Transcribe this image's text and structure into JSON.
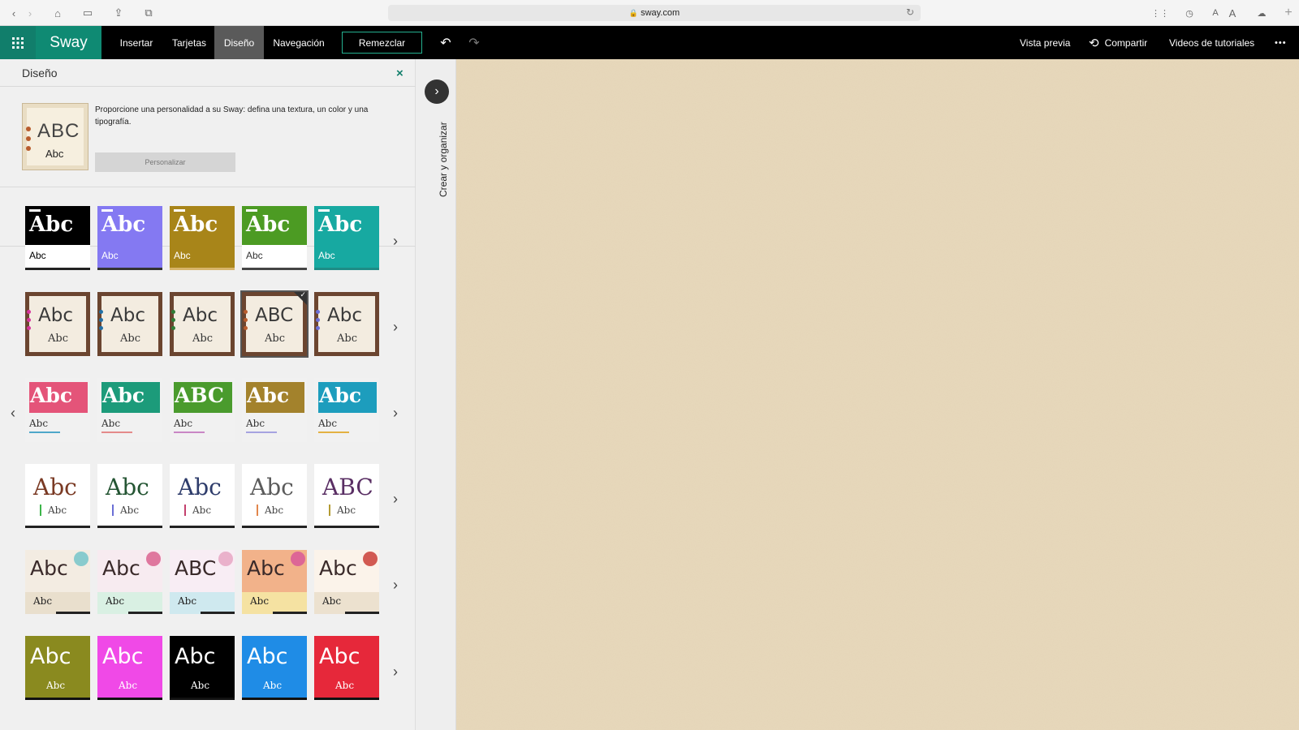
{
  "browser": {
    "url": "sway.com"
  },
  "app": {
    "name": "Sway",
    "tabs": [
      "Insertar",
      "Tarjetas",
      "Diseño",
      "Navegación"
    ],
    "active_tab": "Diseño",
    "remix_label": "Remezclar",
    "preview_label": "Vista previa",
    "share_label": "Compartir",
    "tutorials_label": "Videos de tutoriales",
    "more_label": "•••"
  },
  "design_panel": {
    "title": "Diseño",
    "close_glyph": "×",
    "intro_text": "Proporcione una personalidad a su Sway: defina una textura, un color y una tipografía.",
    "customize_label": "Personalizar",
    "thumb_heading": "ABC",
    "thumb_sub": "Abc"
  },
  "strip": {
    "label": "Crear y organizar",
    "expand_glyph": "›"
  },
  "style_rows": [
    {
      "kind": "solid-bar",
      "tiles": [
        {
          "bg": "#000000",
          "heading": "Abc",
          "sub": "Abc",
          "text": "#ffffff",
          "accent": "#222222",
          "subBg": "#ffffff",
          "subText": "#000000"
        },
        {
          "bg": "#8479f2",
          "heading": "Abc",
          "sub": "Abc",
          "text": "#ffffff",
          "accent": "#333333",
          "subBg": "#8479f2",
          "subText": "#ffffff"
        },
        {
          "bg": "#a88519",
          "heading": "Abc",
          "sub": "Abc",
          "text": "#ffffff",
          "accent": "#d7b46a",
          "subBg": "#a88519",
          "subText": "#ffffff"
        },
        {
          "bg": "#4c9b23",
          "heading": "Abc",
          "sub": "Abc",
          "text": "#ffffff",
          "accent": "#444444",
          "subBg": "#ffffff",
          "subText": "#333333"
        },
        {
          "bg": "#17a9a1",
          "heading": "Abc",
          "sub": "Abc",
          "text": "#ffffff",
          "accent": "#1e8c86",
          "subBg": "#17a9a1",
          "subText": "#ffffff"
        }
      ]
    },
    {
      "kind": "wood",
      "tiles": [
        {
          "heading": "Abc",
          "sub": "Abc",
          "dots": "#d6339c",
          "selected": false
        },
        {
          "heading": "Abc",
          "sub": "Abc",
          "dots": "#216fa6",
          "selected": false
        },
        {
          "heading": "Abc",
          "sub": "Abc",
          "dots": "#2f7d37",
          "selected": false
        },
        {
          "heading": "ABC",
          "sub": "Abc",
          "dots": "#b85c2d",
          "selected": true
        },
        {
          "heading": "Abc",
          "sub": "Abc",
          "dots": "#6b6fd6",
          "selected": false
        }
      ]
    },
    {
      "kind": "banner",
      "tiles": [
        {
          "bg": "#e45479",
          "heading": "Abc",
          "sub": "Abc",
          "line": "#4ea7c9"
        },
        {
          "bg": "#1c9b7a",
          "heading": "Abc",
          "sub": "Abc",
          "line": "#e48a8a"
        },
        {
          "bg": "#4a9b2d",
          "heading": "ABC",
          "sub": "Abc",
          "line": "#c987c5"
        },
        {
          "bg": "#a3822c",
          "heading": "Abc",
          "sub": "Abc",
          "line": "#a6a3e0"
        },
        {
          "bg": "#1d9dbd",
          "heading": "Abc",
          "sub": "Abc",
          "line": "#e3b142"
        }
      ]
    },
    {
      "kind": "serif-white",
      "tiles": [
        {
          "heading": "Abc",
          "sub": "Abc",
          "color": "#7a3a24",
          "accent": "#3cb54a"
        },
        {
          "heading": "Abc",
          "sub": "Abc",
          "color": "#245533",
          "accent": "#6b6fd6"
        },
        {
          "heading": "Abc",
          "sub": "Abc",
          "color": "#2e3c6b",
          "accent": "#c3406d"
        },
        {
          "heading": "Abc",
          "sub": "Abc",
          "color": "#5b5b5b",
          "accent": "#e2864c"
        },
        {
          "heading": "ABC",
          "sub": "Abc",
          "color": "#5a2f64",
          "accent": "#b39b33"
        }
      ]
    },
    {
      "kind": "scrapbook",
      "tiles": [
        {
          "heading": "Abc",
          "sub": "Abc",
          "bg": "#f3ece2",
          "band": "#e9dfcd",
          "accent": "#6ec3c8"
        },
        {
          "heading": "Abc",
          "sub": "Abc",
          "bg": "#f7ebf0",
          "band": "#d9f0e3",
          "accent": "#d85a8a"
        },
        {
          "heading": "ABC",
          "sub": "Abc",
          "bg": "#f8edf4",
          "band": "#cfe9ef",
          "accent": "#e6a1c1"
        },
        {
          "heading": "Abc",
          "sub": "Abc",
          "bg": "#f2b28a",
          "band": "#f5e2a2",
          "accent": "#d75298"
        },
        {
          "heading": "Abc",
          "sub": "Abc",
          "bg": "#fbf3ea",
          "band": "#ece1cf",
          "accent": "#c8332b"
        }
      ]
    },
    {
      "kind": "bold-color",
      "tiles": [
        {
          "bg": "#8a8a1f",
          "heading": "Abc",
          "sub": "Abc",
          "text": "#ffffff"
        },
        {
          "bg": "#f049e7",
          "heading": "Abc",
          "sub": "Abc",
          "text": "#ffffff"
        },
        {
          "bg": "#000000",
          "heading": "Abc",
          "sub": "Abc",
          "text": "#ffffff"
        },
        {
          "bg": "#1f8ce6",
          "heading": "Abc",
          "sub": "Abc",
          "text": "#ffffff"
        },
        {
          "bg": "#e6283a",
          "heading": "Abc",
          "sub": "Abc",
          "text": "#ffffff"
        }
      ]
    }
  ],
  "colors": {
    "accent": "#117e6b",
    "canvas": "#e8d9bc"
  }
}
